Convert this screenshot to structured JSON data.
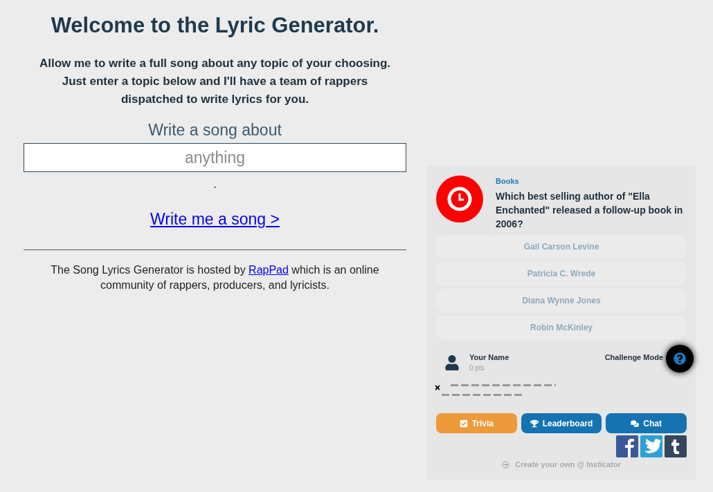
{
  "heading": "Welcome to the Lyric Generator.",
  "intro": "Allow me to write a full song about any topic of your choosing. Just enter a topic below and I'll have a team of rappers dispatched to write lyrics for you.",
  "form": {
    "label": "Write a song about",
    "placeholder": "anything",
    "dot": ".",
    "submit": "Write me a song >"
  },
  "footer": {
    "before": "The Song Lyrics Generator is hosted by ",
    "link": "RapPad",
    "after": " which is an online community of rappers, producers, and lyricists."
  },
  "trivia": {
    "category": "Books",
    "question": "Which best selling author of \"Ella Enchanted\" released a follow-up book in 2006?",
    "answers": [
      "Gail Carson Levine",
      "Patricia C. Wrede",
      "Diana Wynne Jones",
      "Robin McKinley"
    ],
    "player": {
      "name": "Your Name",
      "points": "0 pts"
    },
    "mode": "Challenge Mode",
    "tabs": [
      {
        "label": "Trivia",
        "kind": "trivia",
        "selected": true
      },
      {
        "label": "Leaderboard",
        "kind": "leaderboard",
        "selected": false
      },
      {
        "label": "Chat",
        "kind": "chat",
        "selected": false
      }
    ],
    "credit": "Create your own @ Insticator"
  }
}
